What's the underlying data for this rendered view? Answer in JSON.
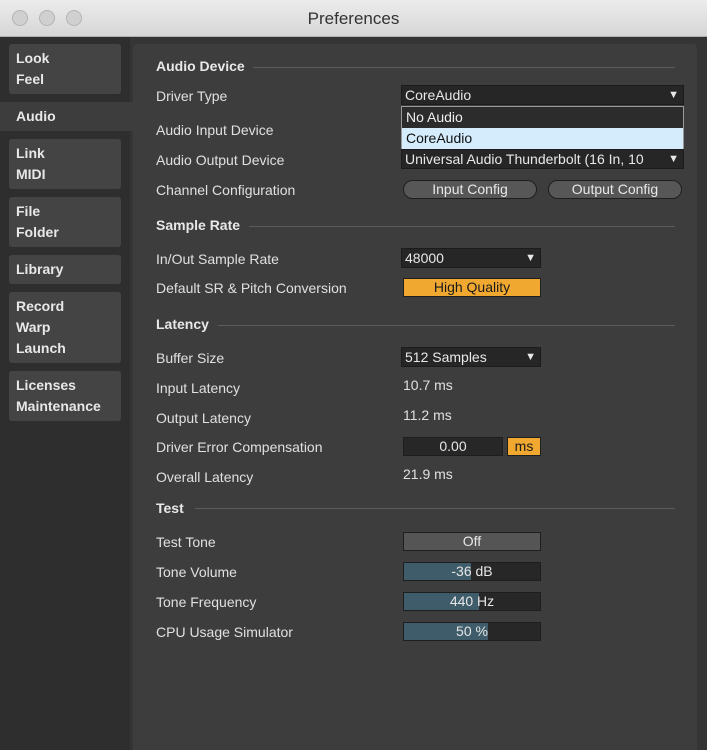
{
  "window": {
    "title": "Preferences"
  },
  "sidebar": {
    "tabs": [
      [
        "Look",
        "Feel"
      ],
      [
        "Audio"
      ],
      [
        "Link",
        "MIDI"
      ],
      [
        "File",
        "Folder"
      ],
      [
        "Library"
      ],
      [
        "Record",
        "Warp",
        "Launch"
      ],
      [
        "Licenses",
        "Maintenance"
      ]
    ],
    "active": "Audio"
  },
  "audio_device": {
    "heading": "Audio Device",
    "driver_type_label": "Driver Type",
    "driver_type": "CoreAudio",
    "driver_options": [
      "No Audio",
      "CoreAudio"
    ],
    "highlighted_option": "CoreAudio",
    "input_label": "Audio Input Device",
    "output_label": "Audio Output Device",
    "output_device": "Universal Audio Thunderbolt (16 In, 10",
    "channel_label": "Channel Configuration",
    "input_config": "Input Config",
    "output_config": "Output Config"
  },
  "sample_rate": {
    "heading": "Sample Rate",
    "rate_label": "In/Out Sample Rate",
    "rate": "48000",
    "conversion_label": "Default SR & Pitch Conversion",
    "conversion": "High Quality",
    "accent": "#f0a830"
  },
  "latency": {
    "heading": "Latency",
    "buffer_label": "Buffer Size",
    "buffer": "512 Samples",
    "input_label": "Input Latency",
    "input": "10.7 ms",
    "output_label": "Output Latency",
    "output": "11.2 ms",
    "comp_label": "Driver Error Compensation",
    "comp": "0.00",
    "comp_unit": "ms",
    "overall_label": "Overall Latency",
    "overall": "21.9 ms"
  },
  "test": {
    "heading": "Test",
    "tone_label": "Test Tone",
    "tone": "Off",
    "volume_label": "Tone Volume",
    "volume": "-36 dB",
    "volume_fill": 0.49,
    "freq_label": "Tone Frequency",
    "freq": "440 Hz",
    "freq_fill": 0.55,
    "cpu_label": "CPU Usage Simulator",
    "cpu": "50 %",
    "cpu_fill": 0.62
  }
}
